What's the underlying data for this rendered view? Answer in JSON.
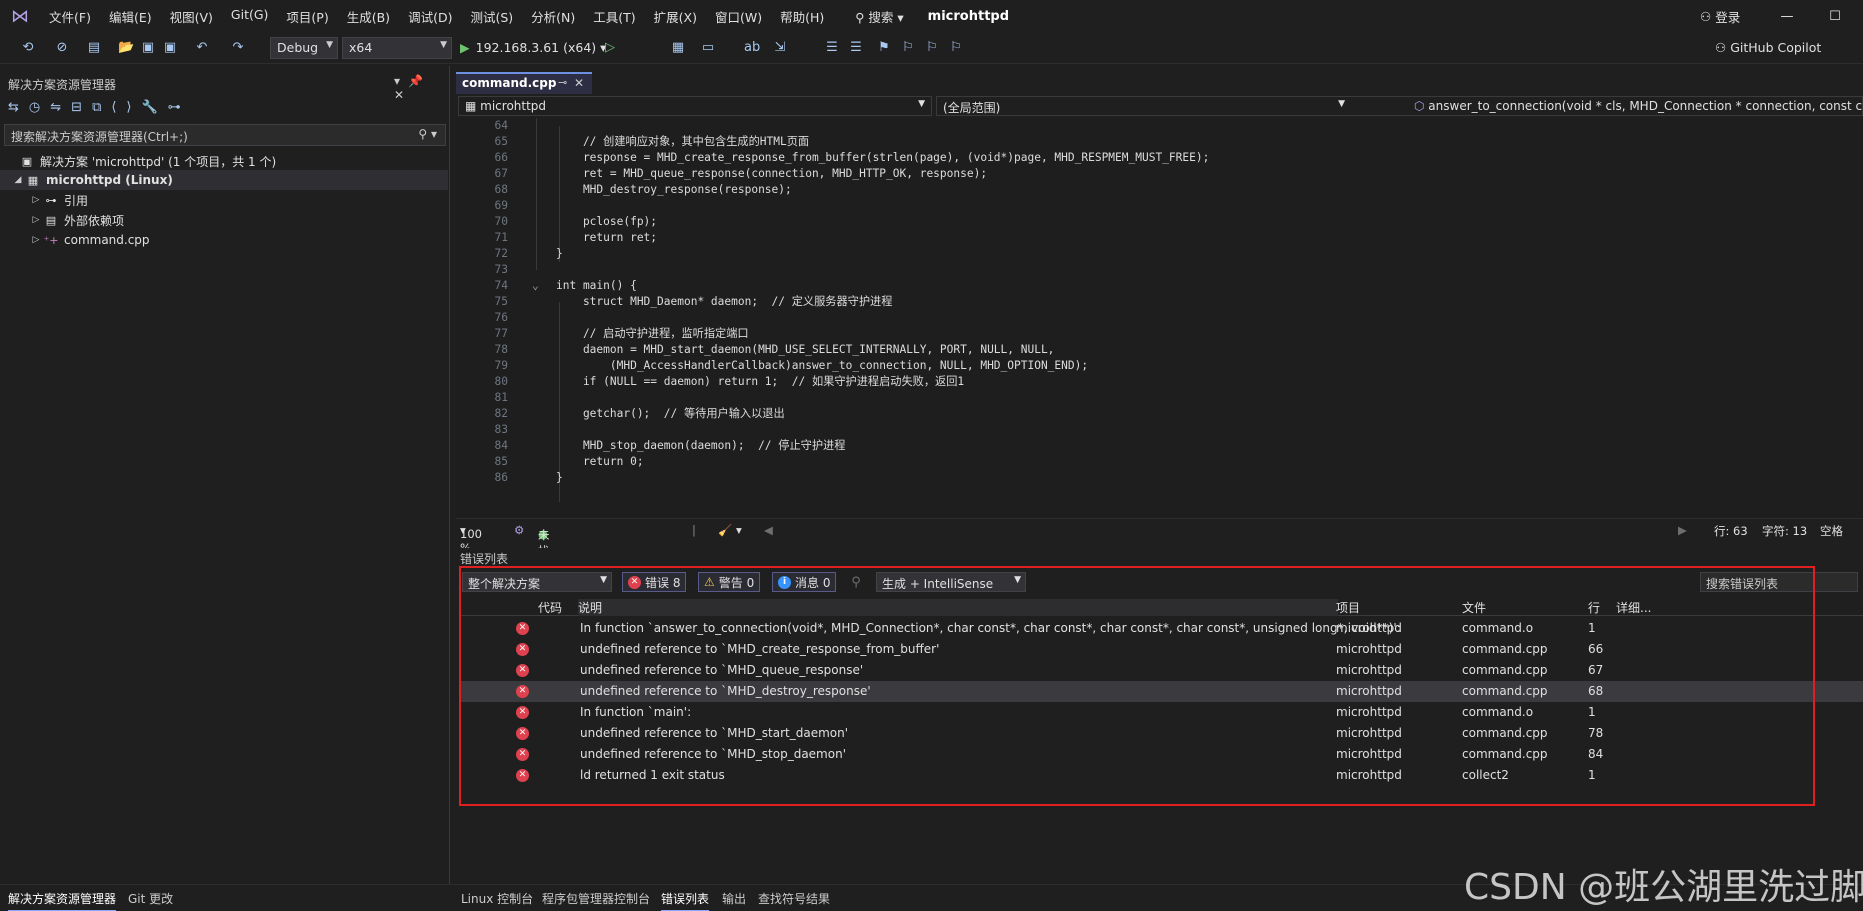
{
  "menubar": {
    "items": [
      "文件(F)",
      "编辑(E)",
      "视图(V)",
      "Git(G)",
      "项目(P)",
      "生成(B)",
      "调试(D)",
      "测试(S)",
      "分析(N)",
      "工具(T)",
      "扩展(X)",
      "窗口(W)",
      "帮助(H)"
    ],
    "search_label": "搜索",
    "app_name": "microhttpd",
    "signin_label": "登录"
  },
  "toolbar": {
    "config": "Debug",
    "platform": "x64",
    "run_target": "192.168.3.61 (x64)",
    "copilot_label": "GitHub Copilot"
  },
  "solution_explorer": {
    "title": "解决方案资源管理器",
    "search_placeholder": "搜索解决方案资源管理器(Ctrl+;)",
    "nodes": [
      {
        "label": "解决方案 'microhttpd' (1 个项目，共 1 个)"
      },
      {
        "label": "microhttpd (Linux)"
      },
      {
        "label": "引用"
      },
      {
        "label": "外部依赖项"
      },
      {
        "label": "command.cpp"
      }
    ]
  },
  "editor": {
    "tab_label": "command.cpp",
    "nav_project": "microhttpd",
    "nav_scope": "(全局范围)",
    "nav_member": "answer_to_connection(void * cls, MHD_Connection * connection, const char",
    "lines": [
      {
        "n": "64",
        "text": ""
      },
      {
        "n": "65",
        "text": "    // 创建响应对象，其中包含生成的HTML页面"
      },
      {
        "n": "66",
        "text": "    response = MHD_create_response_from_buffer(strlen(page), (void*)page, MHD_RESPMEM_MUST_FREE);"
      },
      {
        "n": "67",
        "text": "    ret = MHD_queue_response(connection, MHD_HTTP_OK, response);"
      },
      {
        "n": "68",
        "text": "    MHD_destroy_response(response);"
      },
      {
        "n": "69",
        "text": ""
      },
      {
        "n": "70",
        "text": "    pclose(fp);"
      },
      {
        "n": "71",
        "text": "    return ret;"
      },
      {
        "n": "72",
        "text": "}"
      },
      {
        "n": "73",
        "text": ""
      },
      {
        "n": "74",
        "text": "int main() {"
      },
      {
        "n": "75",
        "text": "    struct MHD_Daemon* daemon;  // 定义服务器守护进程"
      },
      {
        "n": "76",
        "text": ""
      },
      {
        "n": "77",
        "text": "    // 启动守护进程，监听指定端口"
      },
      {
        "n": "78",
        "text": "    daemon = MHD_start_daemon(MHD_USE_SELECT_INTERNALLY, PORT, NULL, NULL,"
      },
      {
        "n": "79",
        "text": "        (MHD_AccessHandlerCallback)answer_to_connection, NULL, MHD_OPTION_END);"
      },
      {
        "n": "80",
        "text": "    if (NULL == daemon) return 1;  // 如果守护进程启动失败，返回1"
      },
      {
        "n": "81",
        "text": ""
      },
      {
        "n": "82",
        "text": "    getchar();  // 等待用户输入以退出"
      },
      {
        "n": "83",
        "text": ""
      },
      {
        "n": "84",
        "text": "    MHD_stop_daemon(daemon);  // 停止守护进程"
      },
      {
        "n": "85",
        "text": "    return 0;"
      },
      {
        "n": "86",
        "text": "}"
      }
    ],
    "status": {
      "zoom": "100 %",
      "issues": "未找到相关问题",
      "line": "行: 63",
      "char": "字符: 13",
      "space": "空格"
    }
  },
  "error_list": {
    "title": "错误列表",
    "scope": "整个解决方案",
    "errors_label": "错误 8",
    "warnings_label": "警告 0",
    "messages_label": "消息 0",
    "source": "生成 + IntelliSense",
    "search_placeholder": "搜索错误列表",
    "headers": {
      "code": "代码",
      "description": "说明",
      "project": "项目",
      "file": "文件",
      "line": "行",
      "details": "详细..."
    },
    "rows": [
      {
        "description": "In function `answer_to_connection(void*, MHD_Connection*, char const*, char const*, char const*, char const*, unsigned long*, void**)':",
        "project": "microhttpd",
        "file": "command.o",
        "line": "1"
      },
      {
        "description": "undefined reference to `MHD_create_response_from_buffer'",
        "project": "microhttpd",
        "file": "command.cpp",
        "line": "66"
      },
      {
        "description": "undefined reference to `MHD_queue_response'",
        "project": "microhttpd",
        "file": "command.cpp",
        "line": "67"
      },
      {
        "description": "undefined reference to `MHD_destroy_response'",
        "project": "microhttpd",
        "file": "command.cpp",
        "line": "68"
      },
      {
        "description": "In function `main':",
        "project": "microhttpd",
        "file": "command.o",
        "line": "1"
      },
      {
        "description": "undefined reference to `MHD_start_daemon'",
        "project": "microhttpd",
        "file": "command.cpp",
        "line": "78"
      },
      {
        "description": "undefined reference to `MHD_stop_daemon'",
        "project": "microhttpd",
        "file": "command.cpp",
        "line": "84"
      },
      {
        "description": "ld returned 1 exit status",
        "project": "microhttpd",
        "file": "collect2",
        "line": "1"
      }
    ]
  },
  "bottom_tabs": {
    "left": [
      "解决方案资源管理器",
      "Git 更改"
    ],
    "right": [
      "Linux 控制台",
      "程序包管理器控制台",
      "错误列表",
      "输出",
      "查找符号结果"
    ]
  },
  "watermark": "CSDN @班公湖里洗过脚",
  "colors": {
    "accent": "#6d8fe0",
    "error": "#e0414f",
    "highlight_box": "#e02020"
  }
}
